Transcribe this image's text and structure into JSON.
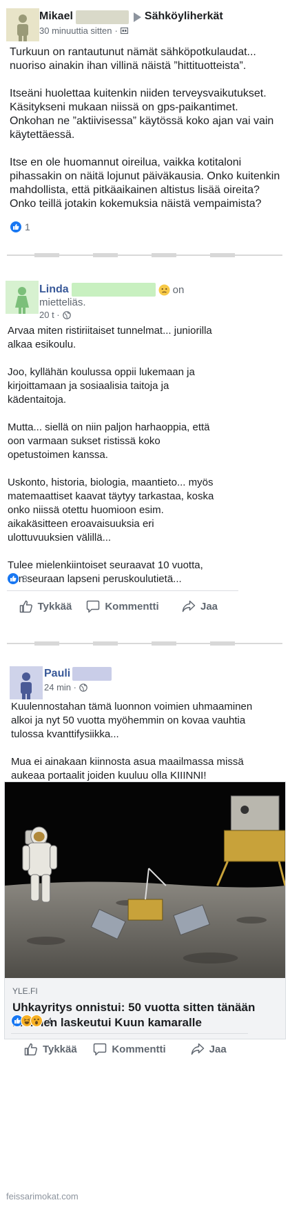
{
  "post1": {
    "author": "Mikael",
    "group": "Sähköyliherkät",
    "time": "30 minuuttia sitten",
    "paragraphs": [
      "Turkuun on rantautunut nämät sähköpotkulaudat... nuoriso ainakin ihan villinä näistä ”hittituotteista”.",
      "Itseäni huolettaa kuitenkin niiden terveysvaikutukset. Käsitykseni mukaan niissä on gps-paikantimet. Onkohan ne ”aktiivisessa” käytössä koko ajan vai vain käytettäessä.",
      "Itse en ole huomannut oireilua, vaikka kotitaloni pihassakin on näitä lojunut päiväkausia. Onko kuitenkin mahdollista, että pitkäaikainen altistus lisää oireita? Onko teillä jotakin kokemuksia näistä vempaimista?"
    ],
    "reaction_count": "1"
  },
  "post2": {
    "author": "Linda",
    "status_on": "on",
    "status_rest": "mietteliäs.",
    "time": "20 t ·",
    "paragraphs": [
      "Arvaa miten ristiriitaiset tunnelmat... juniorilla alkaa esikoulu.",
      "Joo, kyllähän koulussa oppii lukemaan ja kirjoittamaan ja sosiaalisia taitoja ja kädentaitoja.",
      "Mutta... siellä on niin paljon harhaoppia, että oon varmaan sukset ristissä koko opetustoimen kanssa.",
      "Uskonto, historia, biologia, maantieto... myös matemaattiset kaavat täytyy tarkastaa, koska onko niissä otettu huomioon esim. aikakäsitteen eroavaisuuksia eri ulottuvuuksien välillä...",
      "Tulee mielenkiintoiset seuraavat 10 vuotta, kun seuraan lapseni peruskoulutietä..."
    ],
    "reaction_count": "8",
    "actions": {
      "like": "Tykkää",
      "comment": "Kommentti",
      "share": "Jaa"
    }
  },
  "post3": {
    "author": "Pauli",
    "time": "24 min ·",
    "paragraphs": [
      "Kuulennostahan tämä luonnon voimien uhmaaminen alkoi ja nyt 50 vuotta myöhemmin on kovaa vauhtia tulossa kvanttifysiikka...",
      "Mua ei ainakaan kiinnosta asua maailmassa missä aukeaa portaalit joiden kuuluu olla KIIINNI!"
    ],
    "link": {
      "domain": "YLE.FI",
      "title": "Uhkayritys onnistui: 50 vuotta sitten tänään ihminen laskeutui Kuun kamaralle"
    },
    "reaction_count": "4",
    "actions": {
      "like": "Tykkää",
      "comment": "Kommentti",
      "share": "Jaa"
    }
  },
  "watermark": "feissarimokat.com",
  "colors": {
    "link_blue": "#385898",
    "like_blue": "#1877f2",
    "redact_gray": "#d9d9c9",
    "redact_green": "#c8f0c0",
    "redact_blue": "#c9cde8"
  }
}
